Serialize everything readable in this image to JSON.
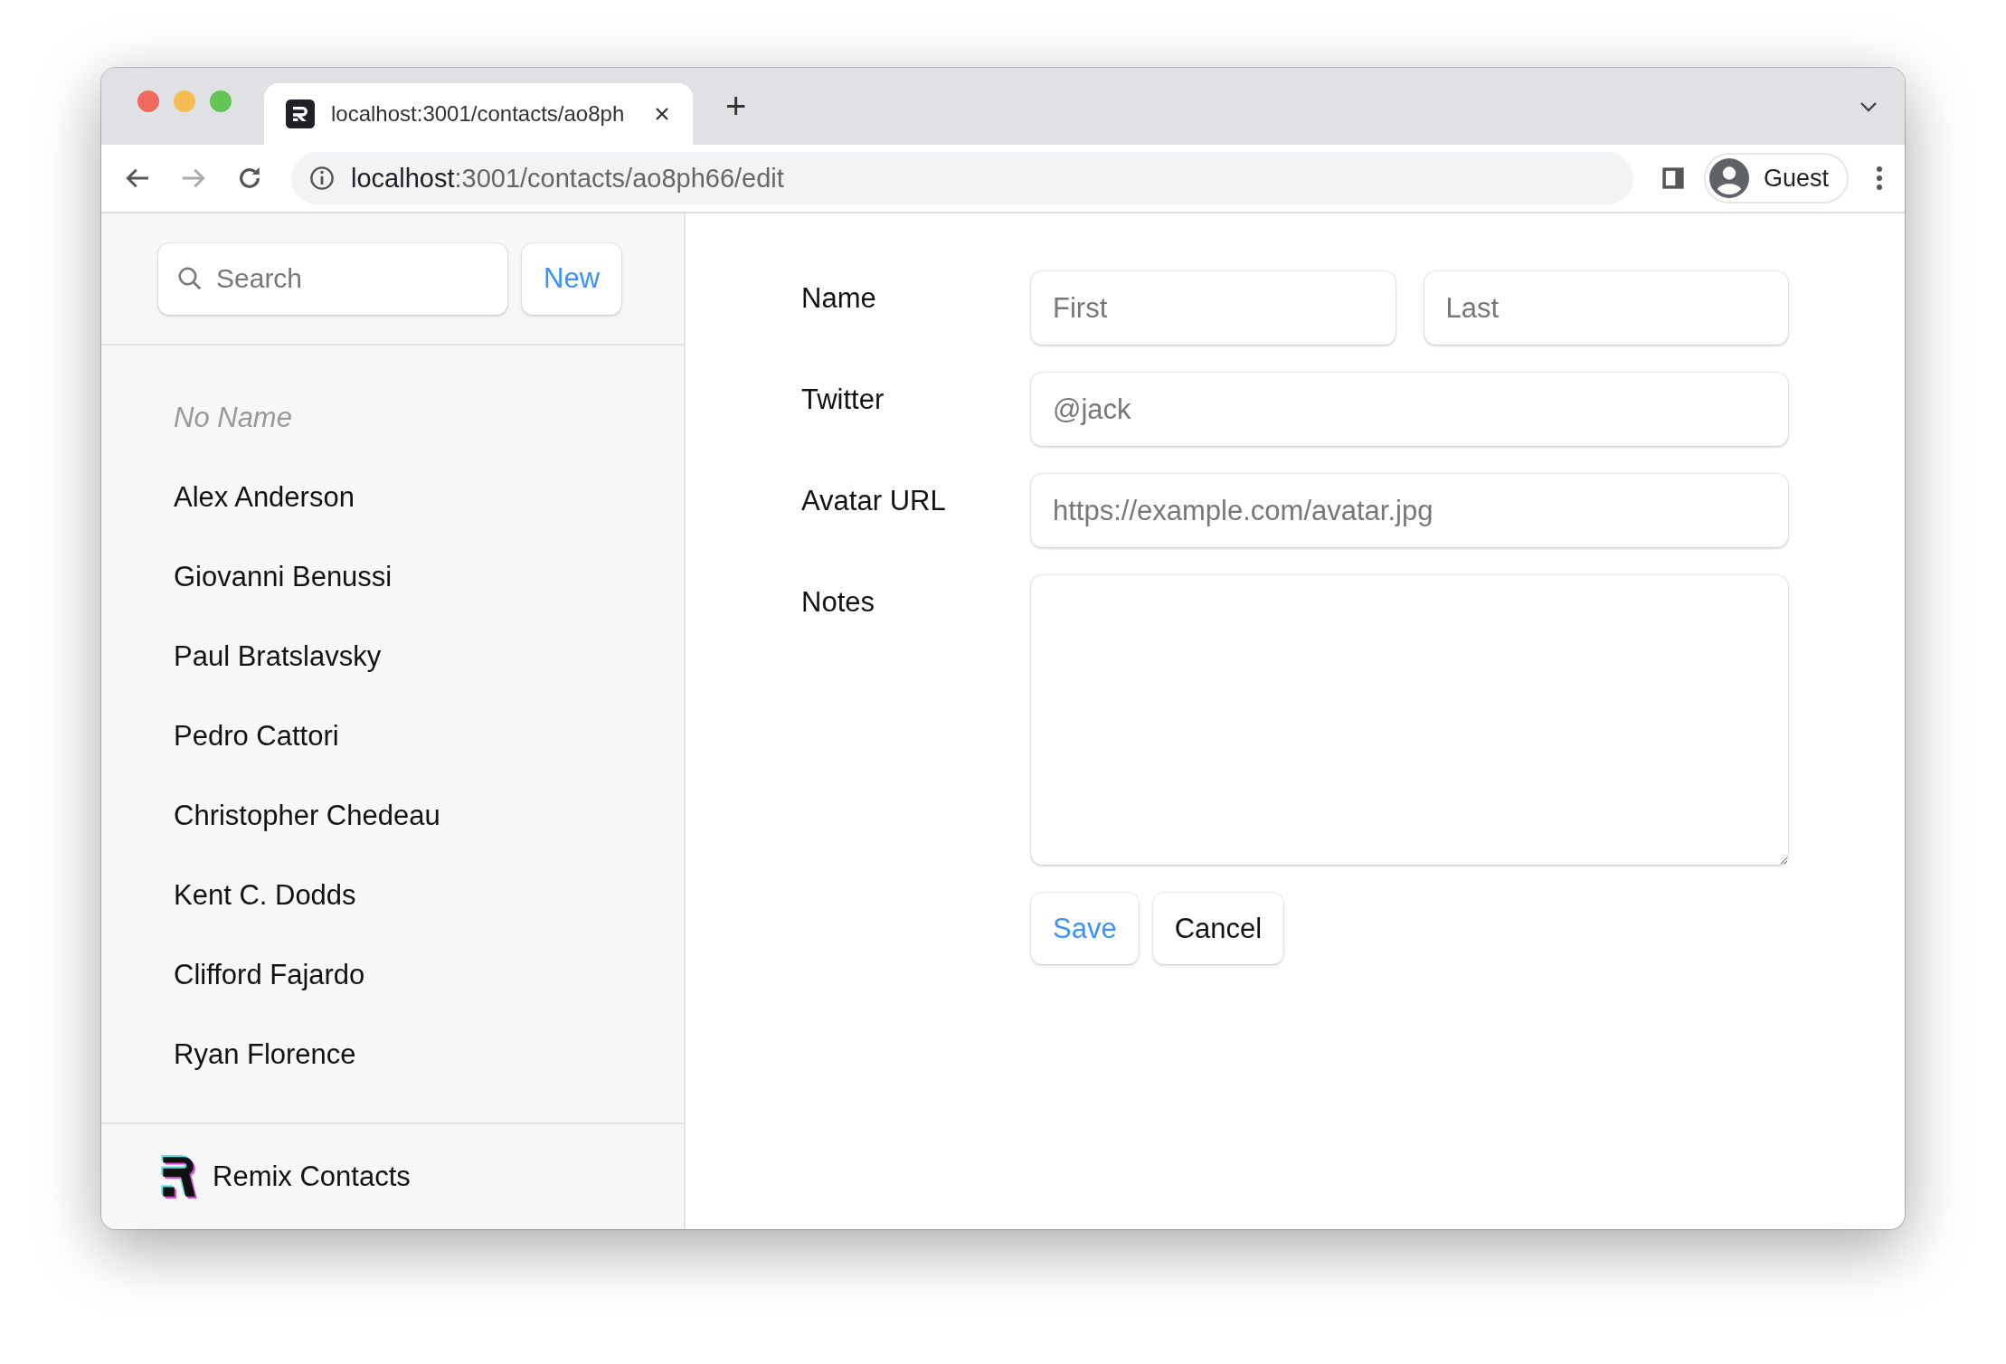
{
  "browser": {
    "tab": {
      "title": "localhost:3001/contacts/ao8ph",
      "selected": true
    },
    "new_tab": "+",
    "url_host": "localhost",
    "url_path": ":3001/contacts/ao8ph66/edit",
    "profile": "Guest"
  },
  "sidebar": {
    "search": {
      "placeholder": "Search"
    },
    "new_button": "New",
    "contacts": [
      {
        "name": "No Name",
        "kind": "empty"
      },
      {
        "name": "Alex Anderson",
        "kind": "named"
      },
      {
        "name": "Giovanni Benussi",
        "kind": "named"
      },
      {
        "name": "Paul Bratslavsky",
        "kind": "named"
      },
      {
        "name": "Pedro Cattori",
        "kind": "named"
      },
      {
        "name": "Christopher Chedeau",
        "kind": "named"
      },
      {
        "name": "Kent C. Dodds",
        "kind": "named"
      },
      {
        "name": "Clifford Fajardo",
        "kind": "named"
      },
      {
        "name": "Ryan Florence",
        "kind": "named"
      }
    ],
    "footer": "Remix Contacts"
  },
  "form": {
    "rows": [
      {
        "label": "Name",
        "kind": "pair",
        "fields": [
          {
            "placeholder": "First"
          },
          {
            "placeholder": "Last"
          }
        ]
      },
      {
        "label": "Twitter",
        "kind": "single",
        "fields": [
          {
            "placeholder": "@jack"
          }
        ]
      },
      {
        "label": "Avatar URL",
        "kind": "single",
        "fields": [
          {
            "placeholder": "https://example.com/avatar.jpg"
          }
        ]
      },
      {
        "label": "Notes",
        "kind": "area"
      }
    ],
    "buttons": [
      {
        "label": "Save",
        "kind": "primary"
      },
      {
        "label": "Cancel",
        "kind": "secondary"
      }
    ]
  }
}
